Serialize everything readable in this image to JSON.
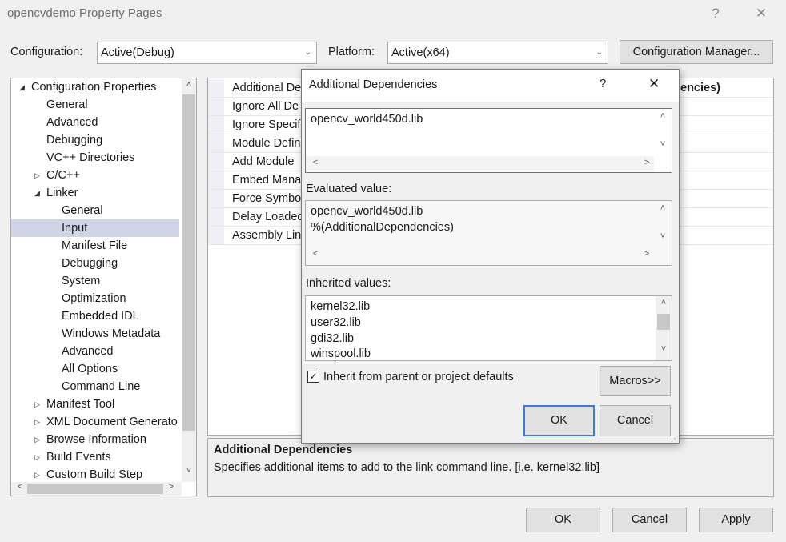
{
  "window": {
    "title": "opencvdemo Property Pages",
    "help_icon": "?",
    "close_icon": "✕"
  },
  "config": {
    "configuration_label": "Configuration:",
    "configuration_value": "Active(Debug)",
    "platform_label": "Platform:",
    "platform_value": "Active(x64)",
    "manager_button": "Configuration Manager..."
  },
  "tree": {
    "items": [
      {
        "label": "Configuration Properties",
        "level": 0,
        "expander": "expanded"
      },
      {
        "label": "General",
        "level": 1,
        "expander": "none"
      },
      {
        "label": "Advanced",
        "level": 1,
        "expander": "none"
      },
      {
        "label": "Debugging",
        "level": 1,
        "expander": "none"
      },
      {
        "label": "VC++ Directories",
        "level": 1,
        "expander": "none"
      },
      {
        "label": "C/C++",
        "level": 1,
        "expander": "collapsed"
      },
      {
        "label": "Linker",
        "level": 1,
        "expander": "expanded"
      },
      {
        "label": "General",
        "level": 2,
        "expander": "none"
      },
      {
        "label": "Input",
        "level": 2,
        "expander": "none",
        "selected": true
      },
      {
        "label": "Manifest File",
        "level": 2,
        "expander": "none"
      },
      {
        "label": "Debugging",
        "level": 2,
        "expander": "none"
      },
      {
        "label": "System",
        "level": 2,
        "expander": "none"
      },
      {
        "label": "Optimization",
        "level": 2,
        "expander": "none"
      },
      {
        "label": "Embedded IDL",
        "level": 2,
        "expander": "none"
      },
      {
        "label": "Windows Metadata",
        "level": 2,
        "expander": "none"
      },
      {
        "label": "Advanced",
        "level": 2,
        "expander": "none"
      },
      {
        "label": "All Options",
        "level": 2,
        "expander": "none"
      },
      {
        "label": "Command Line",
        "level": 2,
        "expander": "none"
      },
      {
        "label": "Manifest Tool",
        "level": 1,
        "expander": "collapsed"
      },
      {
        "label": "XML Document Generato",
        "level": 1,
        "expander": "collapsed"
      },
      {
        "label": "Browse Information",
        "level": 1,
        "expander": "collapsed"
      },
      {
        "label": "Build Events",
        "level": 1,
        "expander": "collapsed"
      },
      {
        "label": "Custom Build Step",
        "level": 1,
        "expander": "collapsed"
      }
    ]
  },
  "grid": {
    "properties": [
      "Additional De",
      "Ignore All De",
      "Ignore Specif",
      "Module Defin",
      "Add Module",
      "Embed Mana",
      "Force Symbo",
      "Delay Loaded",
      "Assembly Lin"
    ],
    "header_right": "encies)"
  },
  "description": {
    "title": "Additional Dependencies",
    "text": "Specifies additional items to add to the link command line. [i.e. kernel32.lib]"
  },
  "footer": {
    "ok": "OK",
    "cancel": "Cancel",
    "apply": "Apply"
  },
  "dialog": {
    "title": "Additional Dependencies",
    "help_icon": "?",
    "close_icon": "✕",
    "edit_value": "opencv_world450d.lib",
    "evaluated_label": "Evaluated value:",
    "evaluated_lines": [
      "opencv_world450d.lib",
      "%(AdditionalDependencies)"
    ],
    "inherited_label": "Inherited values:",
    "inherited_lines": [
      "kernel32.lib",
      "user32.lib",
      "gdi32.lib",
      "winspool.lib"
    ],
    "inherit_checkbox_label": "Inherit from parent or project defaults",
    "inherit_checked": true,
    "check_mark": "✓",
    "macros_button": "Macros>>",
    "ok_button": "OK",
    "cancel_button": "Cancel"
  },
  "colors": {
    "accent": "#3d7bd6",
    "selection": "#cfd5e4"
  }
}
